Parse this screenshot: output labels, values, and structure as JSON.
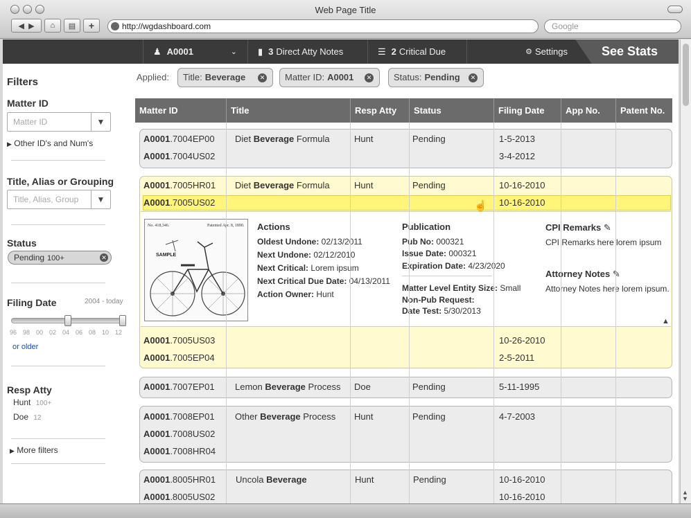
{
  "browser": {
    "title": "Web Page Title",
    "url": "http://wgdashboard.com",
    "search_placeholder": "Google"
  },
  "appbar": {
    "matter": "A0001",
    "notes_count": "3",
    "notes_label": "Direct Atty Notes",
    "critical_count": "2",
    "critical_label": "Critical Due",
    "settings": "Settings",
    "see_stats": "See Stats"
  },
  "sidebar": {
    "filters_title": "Filters",
    "matter_id_title": "Matter ID",
    "matter_id_placeholder": "Matter ID",
    "other_ids": "Other ID's and Num's",
    "title_group_title": "Title, Alias or Grouping",
    "title_placeholder": "Title, Alias, Group",
    "status_title": "Status",
    "status_chip": "Pending",
    "status_chip_count": "100+",
    "filing_date_title": "Filing Date",
    "filing_date_range": "2004 - today",
    "ticks": [
      "96",
      "98",
      "00",
      "02",
      "04",
      "06",
      "08",
      "10",
      "12"
    ],
    "or_older": "or older",
    "resp_atty_title": "Resp Atty",
    "resp_atty": [
      {
        "name": "Hunt",
        "count": "100+"
      },
      {
        "name": "Doe",
        "count": "12"
      }
    ],
    "more_filters": "More filters"
  },
  "applied": {
    "label": "Applied:",
    "chips": [
      {
        "key": "Title:",
        "value": "Beverage"
      },
      {
        "key": "Matter ID:",
        "value": "A0001"
      },
      {
        "key": "Status:",
        "value": "Pending"
      }
    ]
  },
  "table": {
    "headers": [
      "Matter ID",
      "Title",
      "Resp Atty",
      "Status",
      "Filing Date",
      "App No.",
      "Patent No."
    ],
    "groups": [
      {
        "ids": [
          [
            "A0001",
            ".7004EP00"
          ],
          [
            "A0001",
            ".7004US02"
          ]
        ],
        "title": [
          "Diet ",
          "Beverage",
          " Formula"
        ],
        "atty": "Hunt",
        "status": "Pending",
        "dates": [
          "1-5-2013",
          "3-4-2012"
        ]
      },
      {
        "ids": [
          [
            "A0001",
            ".7005HR01"
          ],
          [
            "A0001",
            ".7005US02"
          ]
        ],
        "title": [
          "Diet ",
          "Beverage",
          " Formula"
        ],
        "atty": "Hunt",
        "status": "Pending",
        "dates": [
          "10-16-2010",
          "10-16-2010"
        ],
        "extra_ids": [
          [
            "A0001",
            ".7005US03"
          ],
          [
            "A0001",
            ".7005EP04"
          ]
        ],
        "extra_dates": [
          "10-26-2010",
          "2-5-2011"
        ]
      },
      {
        "ids": [
          [
            "A0001",
            ".7007EP01"
          ]
        ],
        "title": [
          "Lemon ",
          "Beverage",
          " Process"
        ],
        "atty": "Doe",
        "status": "Pending",
        "dates": [
          "5-11-1995"
        ]
      },
      {
        "ids": [
          [
            "A0001",
            ".7008EP01"
          ],
          [
            "A0001",
            ".7008US02"
          ],
          [
            "A0001",
            ".7008HR04"
          ]
        ],
        "title": [
          "Other ",
          "Beverage",
          " Process"
        ],
        "atty": "Hunt",
        "status": "Pending",
        "dates": [
          "4-7-2003"
        ]
      },
      {
        "ids": [
          [
            "A0001",
            ".8005HR01"
          ],
          [
            "A0001",
            ".8005US02"
          ]
        ],
        "title": [
          "Uncola ",
          "Beverage",
          ""
        ],
        "atty": "Hunt",
        "status": "Pending",
        "dates": [
          "10-16-2010",
          "10-16-2010"
        ]
      }
    ]
  },
  "detail": {
    "patent_no_text": "No. 418,346.",
    "patent_date_text": "Patented Apr. 8, 1890.",
    "sample_text": "SAMPLE",
    "actions_title": "Actions",
    "actions": [
      {
        "k": "Oldest Undone:",
        "v": " 02/13/2011"
      },
      {
        "k": "Next Undone:",
        "v": " 02/12/2010"
      },
      {
        "k": "Next Critical:",
        "v": " Lorem ipsum"
      },
      {
        "k": "Next Critical Due Date:",
        "v": " 04/13/2011"
      },
      {
        "k": "Action Owner:",
        "v": " Hunt"
      }
    ],
    "publication_title": "Publication",
    "publication": [
      {
        "k": "Pub No:",
        "v": " 000321"
      },
      {
        "k": "Issue Date:",
        "v": " 000321"
      },
      {
        "k": "Expiration Date:",
        "v": " 4/23/2020"
      }
    ],
    "entity": [
      {
        "k": "Matter Level Entity Size:",
        "v": " Small"
      },
      {
        "k": "Non-Pub Request:",
        "v": ""
      },
      {
        "k": "Date Test:",
        "v": " 5/30/2013"
      }
    ],
    "cpi_title": "CPI Remarks",
    "cpi_text": "CPI Remarks here lorem ipsum",
    "notes_title": "Attorney Notes",
    "notes_text": "Attorney Notes here lorem ipsum."
  }
}
